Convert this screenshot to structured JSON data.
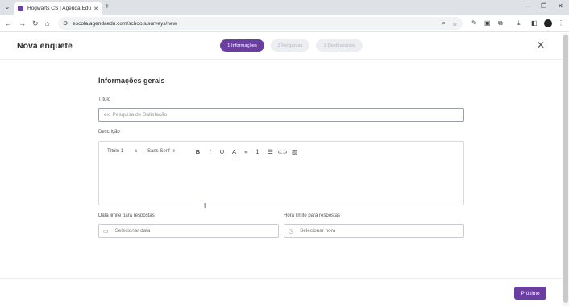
{
  "browser": {
    "tab_title": "Hogwarts CS | Agenda Edu",
    "tab_close": "✕",
    "new_tab": "+",
    "url": "escola.agendaedu.com/schools/surveys/new"
  },
  "page": {
    "title": "Nova enquete",
    "steps": [
      {
        "label": "1 Informações",
        "active": true
      },
      {
        "label": "2 Perguntas",
        "active": false
      },
      {
        "label": "3 Destinatários",
        "active": false
      }
    ],
    "section_title": "Informações gerais",
    "title_field": {
      "label": "Título",
      "placeholder": "ex. Pesquisa de Satisfação"
    },
    "description_field": {
      "label": "Descrição",
      "toolbar": {
        "heading": "Título 1",
        "font": "Sans Serif"
      }
    },
    "deadline_date": {
      "label": "Data limite para respostas",
      "placeholder": "Selecionar data"
    },
    "deadline_time": {
      "label": "Hora limite para respostas",
      "placeholder": "Selecionar hora"
    },
    "next_button": "Próximo"
  },
  "colors": {
    "accent": "#6b3fa0"
  },
  "icons": [
    "tab-search-icon",
    "favicon-icon",
    "back-icon",
    "forward-icon",
    "reload-icon",
    "home-icon",
    "site-info-icon",
    "zoom-icon",
    "bookmark-star-icon",
    "extensions-icon",
    "download-icon",
    "side-panel-icon",
    "menu-icon",
    "close-icon",
    "calendar-icon",
    "clock-icon",
    "bold-icon",
    "italic-icon",
    "underline-icon",
    "text-color-icon",
    "align-icon",
    "ordered-list-icon",
    "bullet-list-icon",
    "link-icon",
    "image-icon"
  ]
}
